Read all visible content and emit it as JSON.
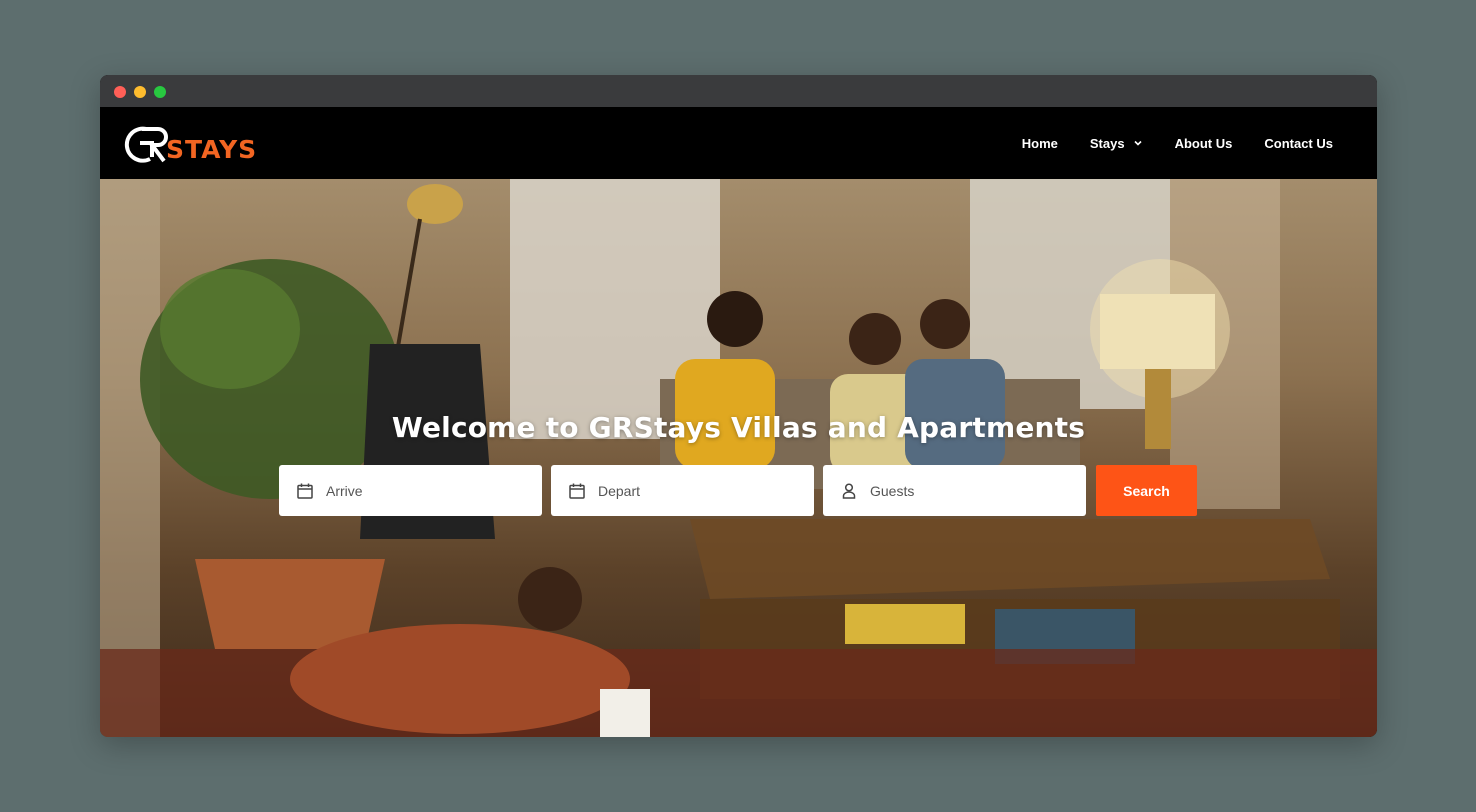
{
  "window": {
    "controls": [
      "close",
      "minimize",
      "maximize"
    ]
  },
  "brand": {
    "logo_text": "STAYS",
    "logo_mark_letters": "GR",
    "accent_color": "#f26522"
  },
  "nav": {
    "items": [
      {
        "label": "Home",
        "has_dropdown": false
      },
      {
        "label": "Stays",
        "has_dropdown": true
      },
      {
        "label": "About Us",
        "has_dropdown": false
      },
      {
        "label": "Contact Us",
        "has_dropdown": false
      }
    ]
  },
  "hero": {
    "title": "Welcome to GRStays Villas and Apartments",
    "image": "family-living-room-photo"
  },
  "search": {
    "arrive_placeholder": "Arrive",
    "depart_placeholder": "Depart",
    "guests_placeholder": "Guests",
    "button_label": "Search",
    "button_color": "#fe5416",
    "icons": [
      "calendar-icon",
      "calendar-icon",
      "user-icon"
    ]
  }
}
